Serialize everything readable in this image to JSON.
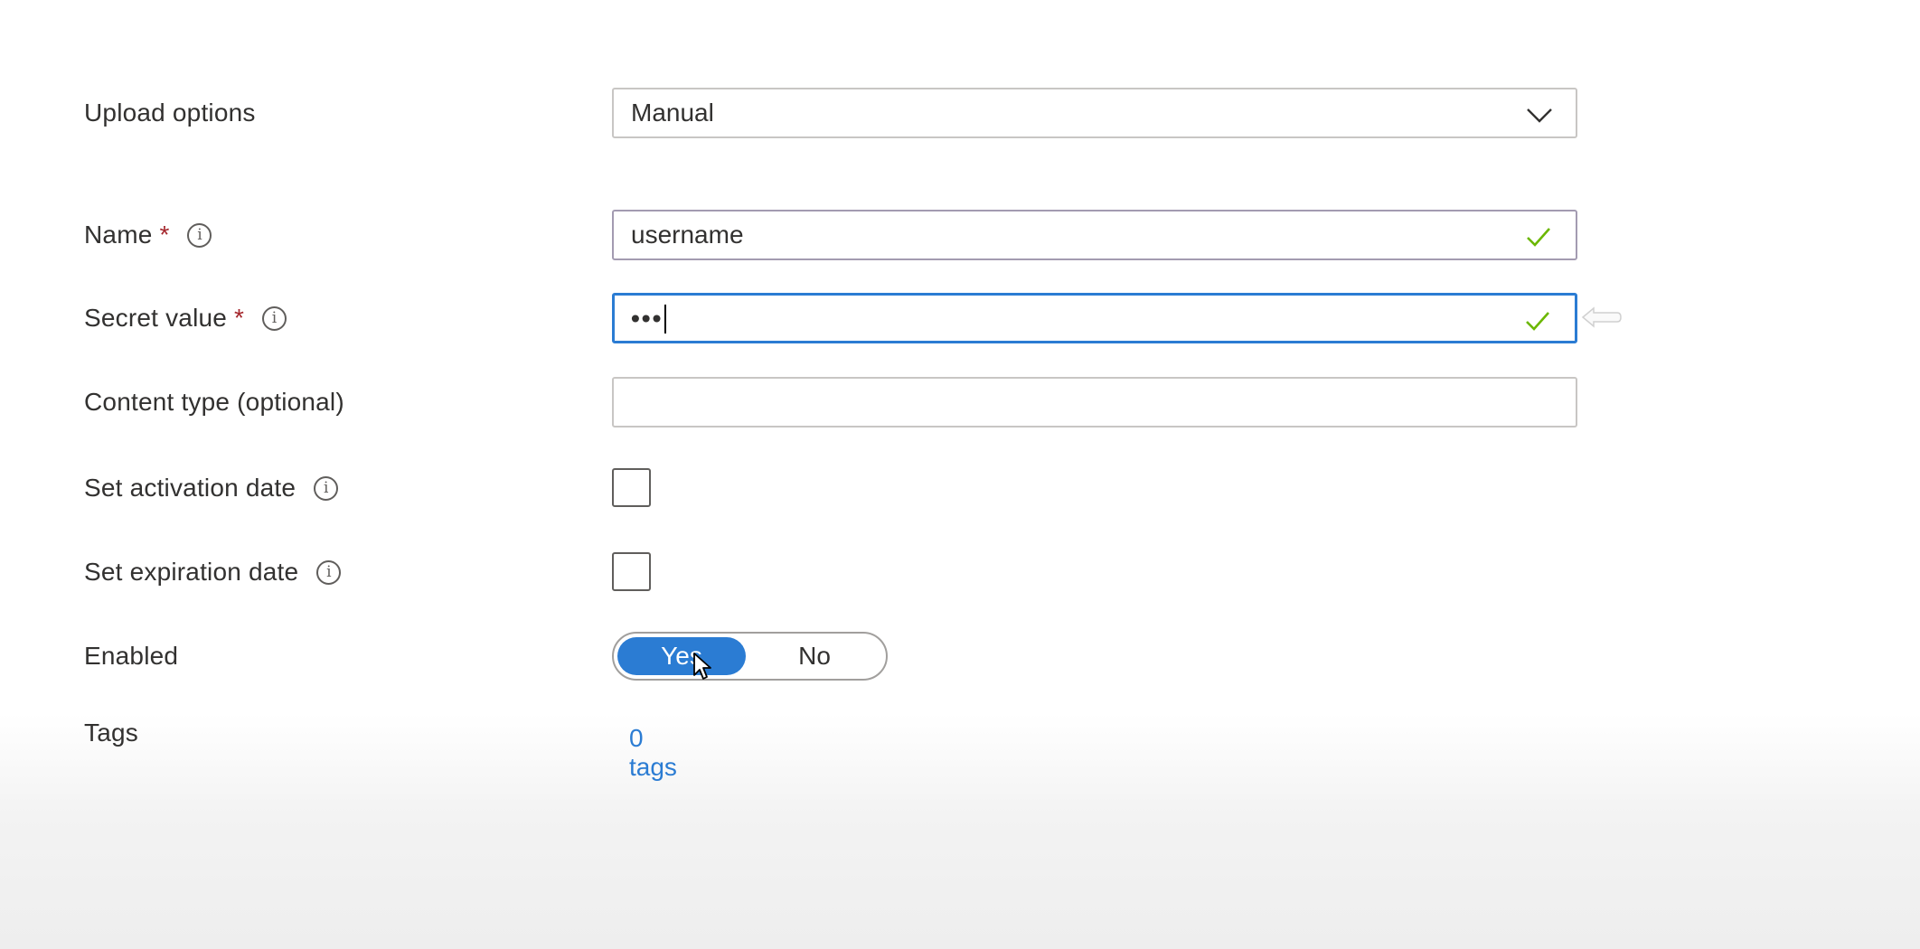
{
  "form": {
    "upload_options": {
      "label": "Upload options",
      "value": "Manual"
    },
    "name": {
      "label": "Name",
      "required_mark": "*",
      "value": "username"
    },
    "secret_value": {
      "label": "Secret value",
      "required_mark": "*",
      "masked_value": "•••"
    },
    "content_type": {
      "label": "Content type (optional)",
      "value": ""
    },
    "activation_date": {
      "label": "Set activation date",
      "checked": false
    },
    "expiration_date": {
      "label": "Set expiration date",
      "checked": false
    },
    "enabled": {
      "label": "Enabled",
      "options": [
        "Yes",
        "No"
      ],
      "selected": "Yes"
    },
    "tags": {
      "label": "Tags",
      "link_text": "0 tags"
    }
  },
  "icons": {
    "info": "info-icon",
    "dropdown": "chevron-down-icon",
    "valid": "checkmark-icon",
    "cursor": "mouse-pointer-icon",
    "hint": "arrow-left-icon"
  },
  "colors": {
    "accent": "#2b7cd3",
    "required": "#a4262c",
    "valid_check": "#6bb700",
    "border": "#c8c6c4"
  }
}
